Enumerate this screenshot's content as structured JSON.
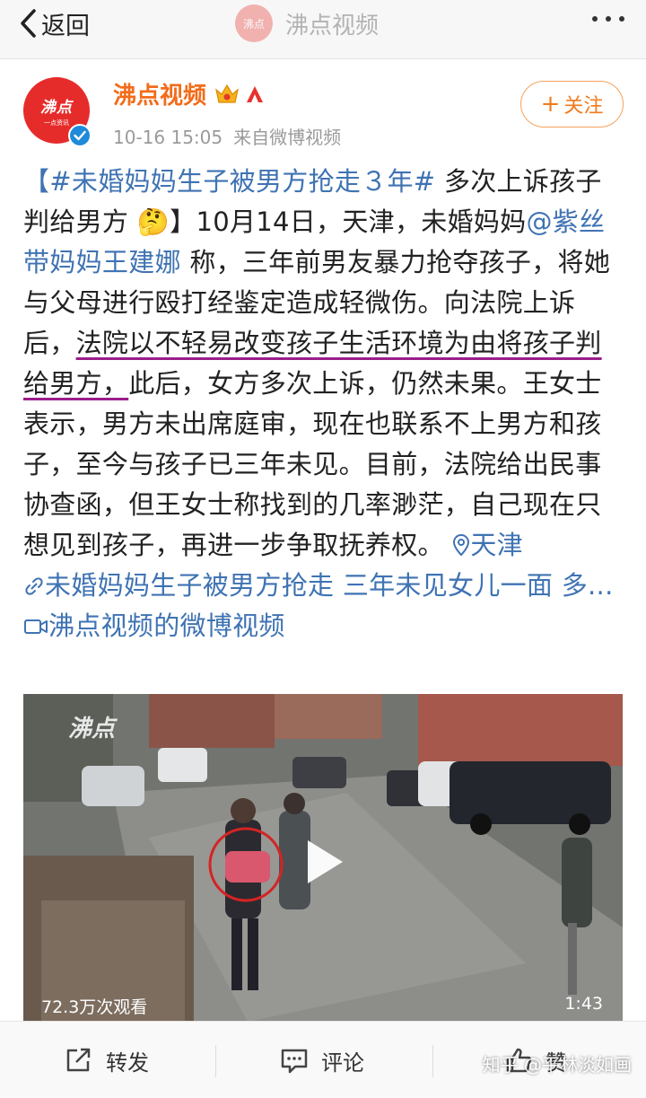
{
  "nav": {
    "back_label": "返回",
    "title": "沸点视频",
    "avatar_text": "沸点"
  },
  "header": {
    "avatar_text": "沸点",
    "avatar_sub": "一点资讯",
    "username": "沸点视频",
    "date": "10-16 15:05",
    "source": "来自微博视频",
    "follow_label": "关注"
  },
  "post": {
    "hashtag": "【#未婚妈妈生子被男方抢走３年#",
    "t1": " 多次上诉孩子判给男方 ",
    "emoji": "🤔",
    "t2": "】10月14日，天津，未婚妈妈",
    "mention": "@紫丝带妈妈王建娜",
    "t3": " 称，三年前男友暴力抢夺孩子，将她与父母进行殴打经鉴定造成轻微伤。向法院上诉后，",
    "underlined": "法院以不轻易改变孩子生活环境为由将孩子判给男方，",
    "t4": "此后，女方多次上诉，仍然未果。王女士表示，男方未出席庭审，现在也联系不上男方和孩子，至今与孩子已三年未见。目前，法院给出民事协查函，但王女士称找到的几率渺茫，自己现在只想见到孩子，再进一步争取抚养权。",
    "location": "天津",
    "link_text": "未婚妈妈生子被男方抢走 三年未见女儿一面 多...",
    "video_link": "沸点视频的微博视频"
  },
  "video": {
    "logo": "沸点",
    "views": "72.3万次观看",
    "duration": "1:43"
  },
  "actions": {
    "repost": "转发",
    "comment": "评论",
    "like": "赞"
  },
  "watermark": "知乎 @平林淡如画",
  "colors": {
    "brand_red": "#e62c2a",
    "username_orange": "#f26c1a",
    "link_blue": "#3f73b3",
    "verified_blue": "#1f8ad9",
    "underline_purple": "#9c1e8c"
  }
}
